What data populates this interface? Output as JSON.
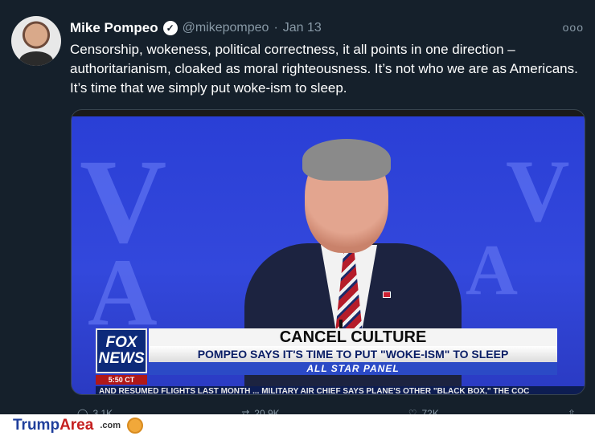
{
  "tweet": {
    "name": "Mike Pompeo",
    "handle": "@mikepompeo",
    "separator": "·",
    "date": "Jan 13",
    "more": "ooo",
    "text": "Censorship, wokeness, political correctness, it all points in one direction – authoritarianism, cloaked as moral righteousness. It’s not who we are as Americans. It’s time that we simply put woke-ism to sleep."
  },
  "media": {
    "network_line1": "FOX",
    "network_line2": "NEWS",
    "time": "5:50 CT",
    "headline": "CANCEL CULTURE",
    "subheadline": "POMPEO SAYS IT'S TIME TO PUT \"WOKE-ISM\" TO SLEEP",
    "panel": "ALL STAR PANEL",
    "ticker": "AND RESUMED FLIGHTS LAST MONTH ...   MILITARY AIR CHIEF SAYS PLANE'S OTHER \"BLACK BOX,\" THE COC"
  },
  "actions": {
    "reply_count": "3.1K",
    "retweet_count": "20.9K",
    "like_count": "72K"
  },
  "watermark": {
    "brand": "Trump",
    "brand_accent": "Area",
    "suffix": ".com"
  }
}
